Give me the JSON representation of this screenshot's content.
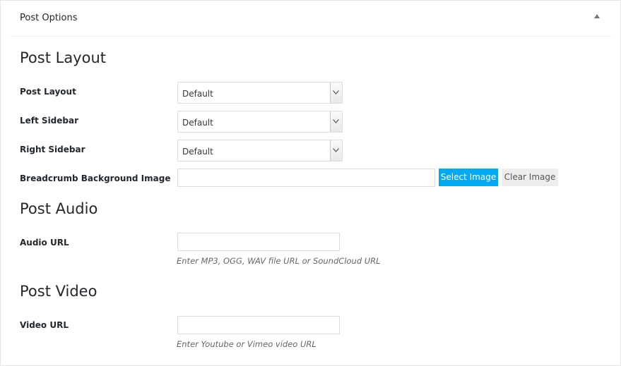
{
  "metabox": {
    "title": "Post Options"
  },
  "sections": {
    "layout_heading": "Post Layout",
    "audio_heading": "Post Audio",
    "video_heading": "Post Video"
  },
  "fields": {
    "post_layout": {
      "label": "Post Layout",
      "value": "Default"
    },
    "left_sidebar": {
      "label": "Left Sidebar",
      "value": "Default"
    },
    "right_sidebar": {
      "label": "Right Sidebar",
      "value": "Default"
    },
    "breadcrumb_bg": {
      "label": "Breadcrumb Background Image",
      "value": "",
      "select_button": "Select Image",
      "clear_button": "Clear Image"
    },
    "audio_url": {
      "label": "Audio URL",
      "value": "",
      "help": "Enter MP3, OGG, WAV file URL or SoundCloud URL"
    },
    "video_url": {
      "label": "Video URL",
      "value": "",
      "help": "Enter Youtube or Vimeo video URL"
    }
  },
  "colors": {
    "accent": "#03a9f4",
    "secondary_button": "#eeeeee",
    "border": "#dddddd"
  },
  "icons": {
    "toggle": "triangle-up-icon",
    "select_arrow": "chevron-down-icon"
  }
}
